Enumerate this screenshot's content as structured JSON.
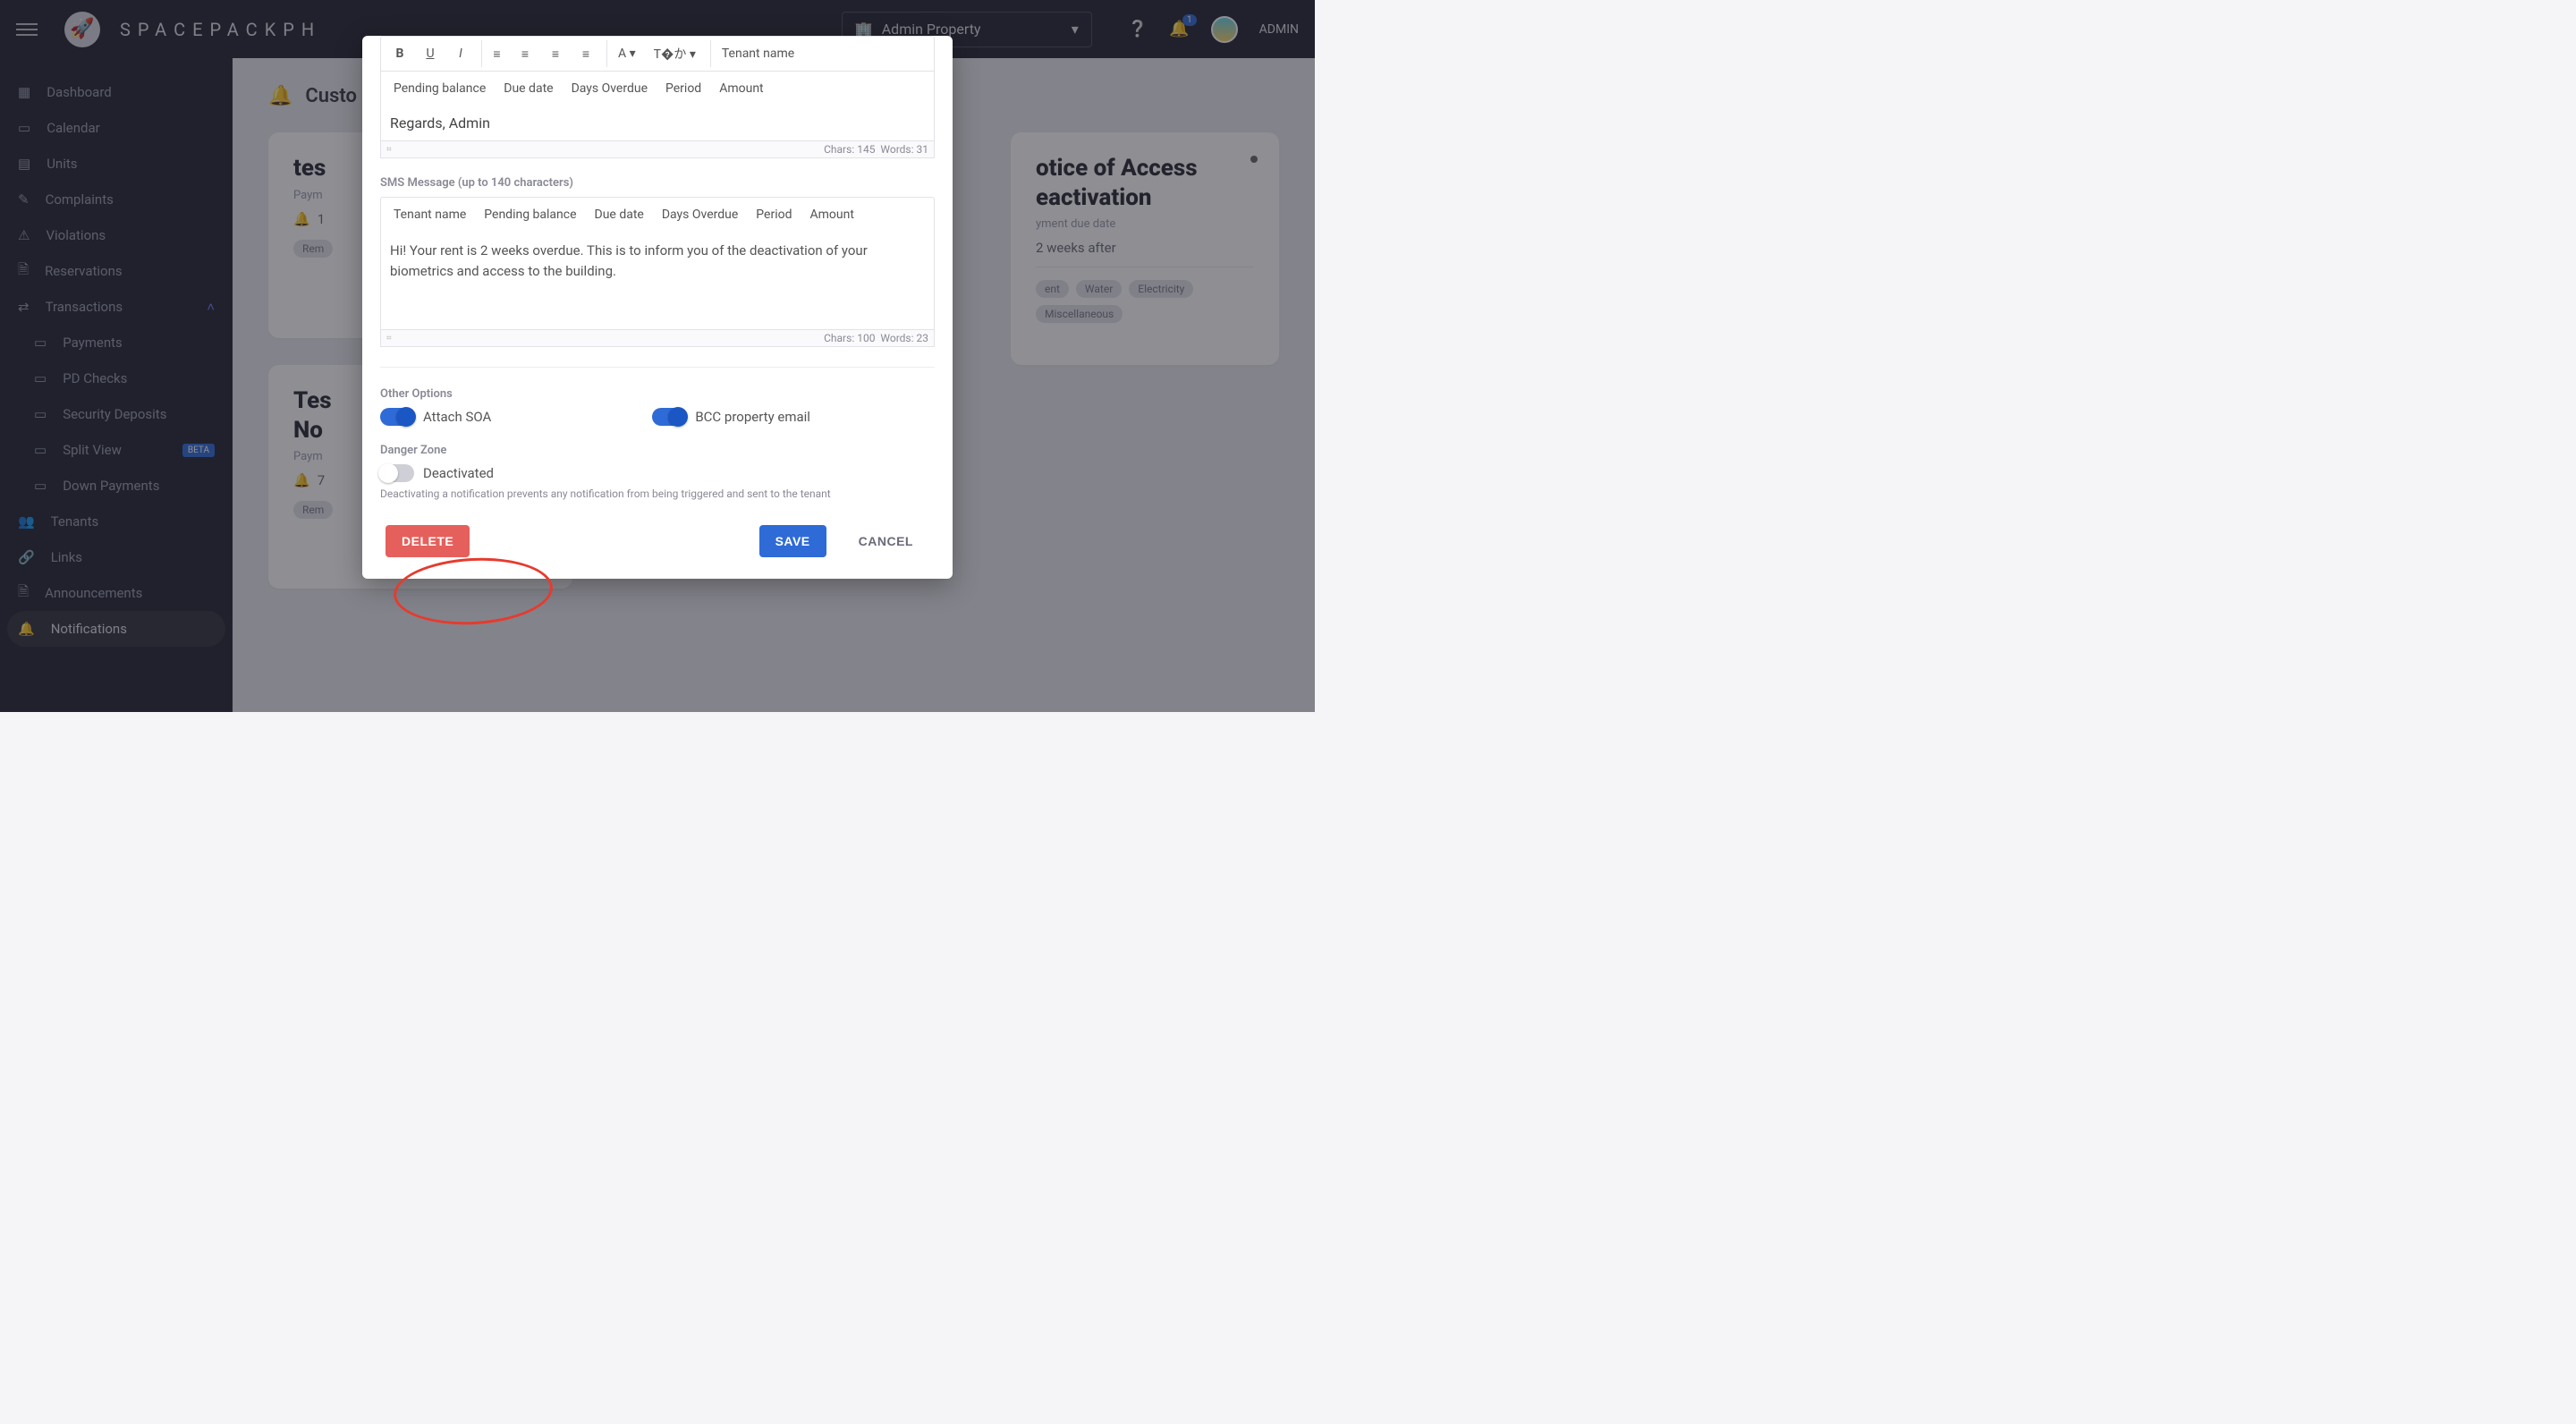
{
  "header": {
    "brand": "SPACEPACKPH",
    "property": "Admin Property",
    "notif_badge": "1",
    "user_label": "ADMIN"
  },
  "sidebar": {
    "items": [
      {
        "label": "Dashboard"
      },
      {
        "label": "Calendar"
      },
      {
        "label": "Units"
      },
      {
        "label": "Complaints"
      },
      {
        "label": "Violations"
      },
      {
        "label": "Reservations"
      },
      {
        "label": "Transactions"
      },
      {
        "label": "Payments"
      },
      {
        "label": "PD Checks"
      },
      {
        "label": "Security Deposits"
      },
      {
        "label": "Split View"
      },
      {
        "label": "Down Payments"
      },
      {
        "label": "Tenants"
      },
      {
        "label": "Links"
      },
      {
        "label": "Announcements"
      },
      {
        "label": "Notifications"
      }
    ],
    "beta_label": "BETA"
  },
  "page": {
    "title_partial": "Custo",
    "card_a": {
      "title_partial": "tes",
      "sub": "Paym",
      "timing": "1",
      "chip": "Rem"
    },
    "card_b": {
      "title_line1": "Tes",
      "title_line2": "No",
      "sub": "Paym",
      "timing": "7",
      "chip": "Rem"
    },
    "card_c": {
      "title_line1": "otice of Access",
      "title_line2": "eactivation",
      "sub": "yment due date",
      "timing": "2 weeks after",
      "chips": [
        "ent",
        "Water",
        "Electricity",
        "Miscellaneous"
      ]
    }
  },
  "modal": {
    "toolbar_placeholders": [
      "Tenant name",
      "Pending balance",
      "Due date",
      "Days Overdue",
      "Period",
      "Amount"
    ],
    "email_body": "Regards, Admin",
    "email_chars": "Chars: 145",
    "email_words": "Words: 31",
    "sms_label": "SMS Message (up to 140 characters)",
    "sms_placeholders": [
      "Tenant name",
      "Pending balance",
      "Due date",
      "Days Overdue",
      "Period",
      "Amount"
    ],
    "sms_body": "Hi! Your rent is 2 weeks overdue. This is to inform you of the deactivation of your biometrics and access to the building.",
    "sms_chars": "Chars: 100",
    "sms_words": "Words: 23",
    "other_options_label": "Other Options",
    "attach_soa_label": "Attach SOA",
    "bcc_label": "BCC property email",
    "danger_zone_label": "Danger Zone",
    "deactivated_label": "Deactivated",
    "deactivated_note": "Deactivating a notification prevents any notification from being triggered and sent to the tenant",
    "delete_label": "DELETE",
    "save_label": "SAVE",
    "cancel_label": "CANCEL"
  }
}
